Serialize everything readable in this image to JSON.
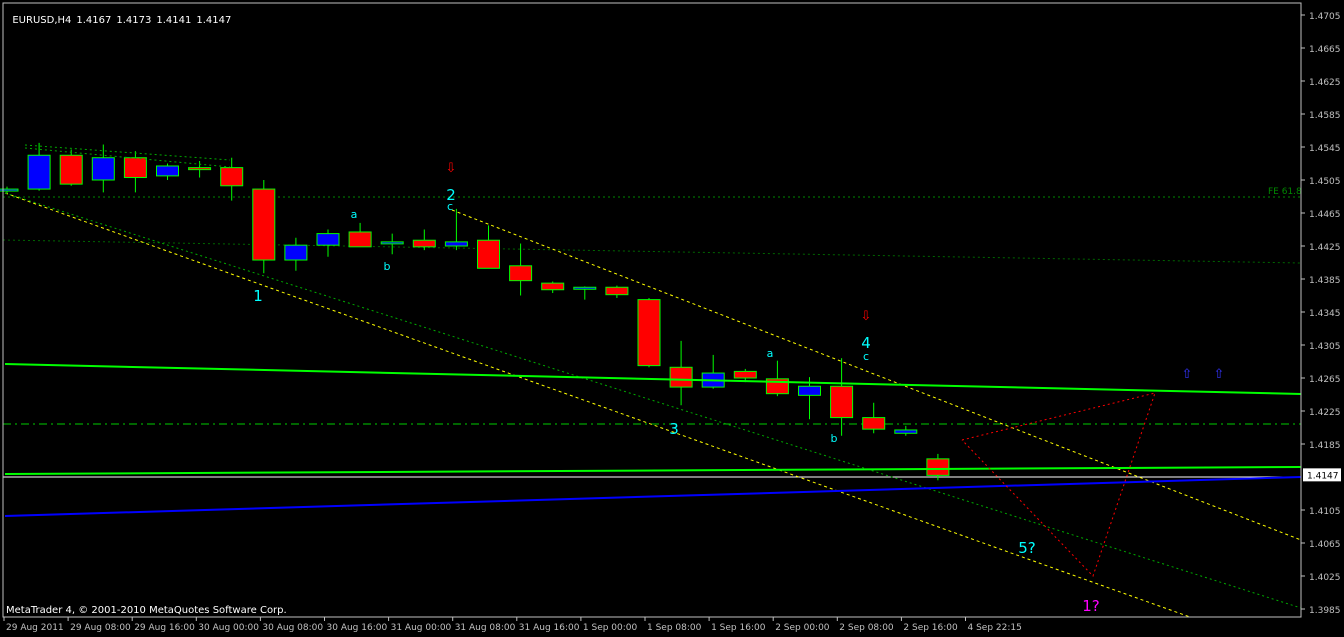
{
  "header": {
    "symbol": "EURUSD,H4",
    "open": "1.4167",
    "high": "1.4173",
    "low": "1.4141",
    "close": "1.4147"
  },
  "copyright": "MetaTrader 4, © 2001-2010 MetaQuotes Software Corp.",
  "colors": {
    "background": "#000000",
    "axis": "#c0c0c0",
    "bull_candle": "#0000ff",
    "bear_candle": "#ff0000",
    "wick": "#00ff00",
    "trend_green": "#00ff00",
    "trend_blue": "#0000ff",
    "channel_yellow": "#ffff00",
    "wave_label": "#00ffff",
    "projection": "#ff0000",
    "magenta_label": "#ff00ff",
    "price_tag_bg": "#ffffff"
  },
  "chart_data": {
    "type": "candlestick",
    "title": "EURUSD,H4",
    "ylim": [
      3.9815,
      1.472
    ],
    "yticks": [
      "1.4705",
      "1.4665",
      "1.4625",
      "1.4585",
      "1.4545",
      "1.4505",
      "1.4465",
      "1.4425",
      "1.4385",
      "1.4345",
      "1.4305",
      "1.4265",
      "1.4225",
      "1.4185",
      "1.4105",
      "1.4065",
      "1.4025",
      "1.3985"
    ],
    "current_price": "1.4147",
    "xticks": [
      "29 Aug 2011",
      "29 Aug 08:00",
      "29 Aug 16:00",
      "30 Aug 00:00",
      "30 Aug 08:00",
      "30 Aug 16:00",
      "31 Aug 00:00",
      "31 Aug 08:00",
      "31 Aug 16:00",
      "1 Sep 00:00",
      "1 Sep 08:00",
      "1 Sep 16:00",
      "2 Sep 00:00",
      "2 Sep 08:00",
      "2 Sep 16:00",
      "4 Sep 22:15"
    ],
    "candles": [
      {
        "o": 1.4492,
        "h": 1.4497,
        "l": 1.4488,
        "c": 1.4494
      },
      {
        "o": 1.4494,
        "h": 1.455,
        "l": 1.4492,
        "c": 1.4535
      },
      {
        "o": 1.4535,
        "h": 1.4542,
        "l": 1.4498,
        "c": 1.45
      },
      {
        "o": 1.4505,
        "h": 1.4548,
        "l": 1.449,
        "c": 1.4532
      },
      {
        "o": 1.4532,
        "h": 1.454,
        "l": 1.449,
        "c": 1.4508
      },
      {
        "o": 1.451,
        "h": 1.4525,
        "l": 1.4505,
        "c": 1.4522
      },
      {
        "o": 1.452,
        "h": 1.4528,
        "l": 1.4508,
        "c": 1.4519
      },
      {
        "o": 1.452,
        "h": 1.4532,
        "l": 1.448,
        "c": 1.4498
      },
      {
        "o": 1.4494,
        "h": 1.4505,
        "l": 1.4392,
        "c": 1.4408
      },
      {
        "o": 1.4408,
        "h": 1.4435,
        "l": 1.4395,
        "c": 1.4426
      },
      {
        "o": 1.4426,
        "h": 1.4445,
        "l": 1.4412,
        "c": 1.444
      },
      {
        "o": 1.4442,
        "h": 1.4453,
        "l": 1.4425,
        "c": 1.4424
      },
      {
        "o": 1.4428,
        "h": 1.444,
        "l": 1.4415,
        "c": 1.443
      },
      {
        "o": 1.4432,
        "h": 1.4445,
        "l": 1.442,
        "c": 1.4424
      },
      {
        "o": 1.4425,
        "h": 1.447,
        "l": 1.442,
        "c": 1.443
      },
      {
        "o": 1.4432,
        "h": 1.445,
        "l": 1.44,
        "c": 1.4398
      },
      {
        "o": 1.4401,
        "h": 1.4428,
        "l": 1.4365,
        "c": 1.4383
      },
      {
        "o": 1.438,
        "h": 1.4382,
        "l": 1.4368,
        "c": 1.4372
      },
      {
        "o": 1.4374,
        "h": 1.4376,
        "l": 1.436,
        "c": 1.4375
      },
      {
        "o": 1.4375,
        "h": 1.4377,
        "l": 1.4362,
        "c": 1.4366
      },
      {
        "o": 1.436,
        "h": 1.4362,
        "l": 1.4278,
        "c": 1.428
      },
      {
        "o": 1.4278,
        "h": 1.431,
        "l": 1.4232,
        "c": 1.4254
      },
      {
        "o": 1.4254,
        "h": 1.4293,
        "l": 1.4252,
        "c": 1.4271
      },
      {
        "o": 1.4273,
        "h": 1.4276,
        "l": 1.426,
        "c": 1.4265
      },
      {
        "o": 1.4264,
        "h": 1.4286,
        "l": 1.4243,
        "c": 1.4246
      },
      {
        "o": 1.4244,
        "h": 1.4266,
        "l": 1.4215,
        "c": 1.4255
      },
      {
        "o": 1.4255,
        "h": 1.4289,
        "l": 1.4195,
        "c": 1.4217
      },
      {
        "o": 1.4217,
        "h": 1.4235,
        "l": 1.4198,
        "c": 1.4203
      },
      {
        "o": 1.4198,
        "h": 1.4207,
        "l": 1.4195,
        "c": 1.4202
      },
      {
        "o": 1.4167,
        "h": 1.4173,
        "l": 1.4141,
        "c": 1.4147
      }
    ],
    "wave_labels": [
      {
        "text": "1",
        "color": "#00ffff"
      },
      {
        "text": "2",
        "color": "#00ffff"
      },
      {
        "text": "c",
        "color": "#00ffff"
      },
      {
        "text": "a",
        "color": "#00ffff"
      },
      {
        "text": "b",
        "color": "#00ffff"
      },
      {
        "text": "3",
        "color": "#00ffff"
      },
      {
        "text": "a",
        "color": "#00ffff"
      },
      {
        "text": "b",
        "color": "#00ffff"
      },
      {
        "text": "4",
        "color": "#00ffff"
      },
      {
        "text": "c",
        "color": "#00ffff"
      },
      {
        "text": "5?",
        "color": "#00ffff"
      },
      {
        "text": "1?",
        "color": "#ff00ff"
      }
    ],
    "fibo_label": "FE 61.8"
  }
}
